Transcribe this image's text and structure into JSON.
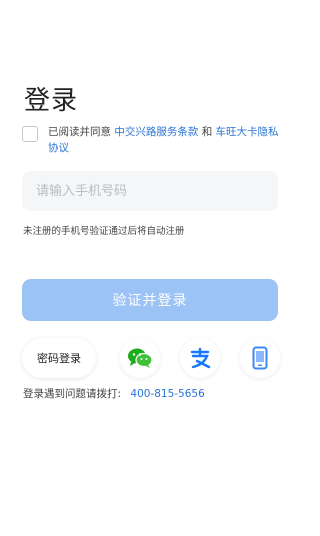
{
  "page": {
    "title": "登录"
  },
  "agreement": {
    "prefix": "已阅读并同意",
    "link1": "中交兴路服务条款",
    "and": "和",
    "link2": "车旺大卡隐私协议"
  },
  "phone_input": {
    "placeholder": "请输入手机号码",
    "value": ""
  },
  "hint": "未注册的手机号验证通过后将自动注册",
  "submit_label": "验证并登录",
  "alt_login": {
    "password_label": "密码登录",
    "icons": [
      "wechat-icon",
      "alipay-icon",
      "mobile-phone-icon"
    ]
  },
  "help": {
    "text": "登录遇到问题请拨打:",
    "phone": "400-815-5656"
  },
  "colors": {
    "accent": "#2a74d4",
    "submit_bg": "#9cc3f6",
    "wechat": "#1aad19",
    "alipay": "#1677ff",
    "mobile": "#3d8af7"
  }
}
